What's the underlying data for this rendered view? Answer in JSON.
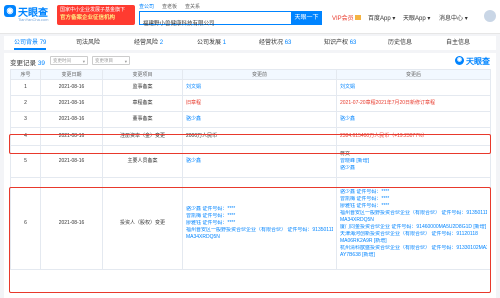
{
  "header": {
    "logo_main": "天眼查",
    "logo_sub": "TianYanCha.com",
    "promo_line1": "国家中小企业发展子基金旗下",
    "promo_line2": "官方备案企业征信机构",
    "search_tabs": [
      "查公司",
      "查老板",
      "查关系"
    ],
    "search_value": "福建野小兽健康科技有限公司",
    "search_button": "天眼一下",
    "vip": "VIP会员",
    "baidu": "百度App",
    "app": "天眼App",
    "messages": "消息中心"
  },
  "tabs": [
    {
      "label": "公司背景",
      "count": "79"
    },
    {
      "label": "司法风险",
      "count": ""
    },
    {
      "label": "经营风险",
      "count": "2"
    },
    {
      "label": "公司发展",
      "count": "1"
    },
    {
      "label": "经营状况",
      "count": "63"
    },
    {
      "label": "知识产权",
      "count": "63"
    },
    {
      "label": "历史信息",
      "count": ""
    },
    {
      "label": "自主信息",
      "count": ""
    }
  ],
  "section": {
    "title": "变更记录",
    "count": "39",
    "filter_date": "变更时间",
    "filter_item": "变更项目",
    "watermark": "天眼查"
  },
  "table": {
    "headers": [
      "序号",
      "变更日期",
      "变更项目",
      "变更前",
      "变更后"
    ],
    "rows": [
      {
        "no": "1",
        "date": "2021-08-16",
        "item": "监事备案",
        "before": "刘文娟",
        "after": "刘文娟"
      },
      {
        "no": "2",
        "date": "2021-08-16",
        "item": "章程备案",
        "before": "旧章程",
        "after": "2021-07-20章程2021年7月20日新修订章程"
      },
      {
        "no": "3",
        "date": "2021-08-16",
        "item": "董事备案",
        "before": "骆少鑫",
        "after": "骆少鑫"
      },
      {
        "no": "4",
        "date": "2021-08-16",
        "item": "注册资本（金）变更",
        "before": "2000万人民币",
        "after": "2384.615400万人民币（+19.23077%）"
      },
      {
        "no": "5",
        "date": "2021-08-16",
        "item": "主要人员备案",
        "before": "骆少鑫",
        "after_lines": [
          "蒋文",
          "曾晓峰 [新增]",
          "骆少鑫"
        ]
      },
      {
        "no": "6",
        "date": "2021-08-16",
        "item": "投资人（股权）变更",
        "before_lines": [
          "骆少鑫 证件号码：****",
          "曾凯梅 证件号码：****",
          "廖雅钰 证件号码：****",
          "福州晋安区一般野投资合伙企业（有限合伙） 证件号码：91350111",
          "MA34XRDQ5N"
        ],
        "after_lines": [
          "骆少鑫 证件号码：****",
          "曾凯梅 证件号码：****",
          "廖雅钰 证件号码：****",
          "福州晋安区一般野投资合伙企业（有限合伙） 证件号码：91350111",
          "MA34XRDQ5N",
          "厦门同金投资合伙企业 证件号码：91460000MA5U2D8G1D [新增]",
          "天津海河创新投资合伙企业（有限合伙） 证件号码：91120118",
          "MA06RK2A9R [新增]",
          "杭州清科歆盛投资合伙企业（有限合伙） 证件号码：91330102MA2",
          "AY7B638 [新增]"
        ]
      }
    ]
  }
}
